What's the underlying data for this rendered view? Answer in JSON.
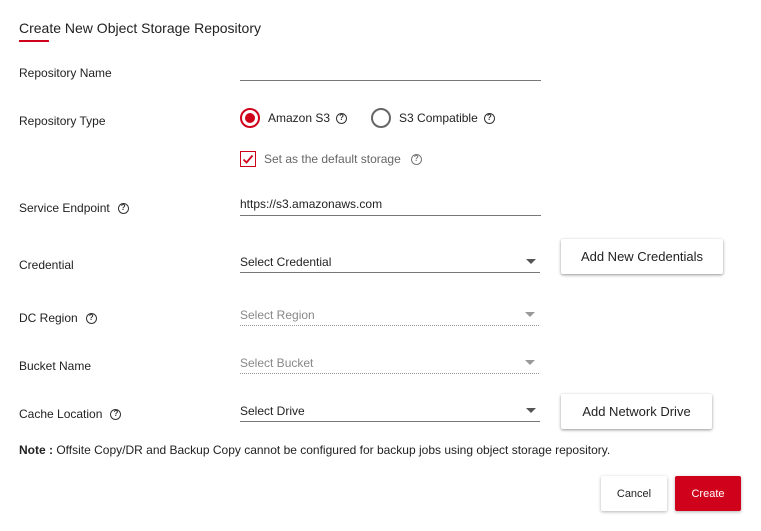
{
  "title": "Create New Object Storage Repository",
  "colors": {
    "accent": "#d0021b"
  },
  "fields": {
    "repository_name": {
      "label": "Repository Name",
      "value": ""
    },
    "repository_type": {
      "label": "Repository Type",
      "options": [
        "Amazon S3",
        "S3 Compatible"
      ],
      "selected": "Amazon S3"
    },
    "default_storage": {
      "label": "Set as the default storage",
      "checked": true
    },
    "service_endpoint": {
      "label": "Service Endpoint",
      "value": "https://s3.amazonaws.com"
    },
    "credential": {
      "label": "Credential",
      "placeholder": "Select Credential",
      "add_button": "Add New Credentials"
    },
    "dc_region": {
      "label": "DC Region",
      "placeholder": "Select Region"
    },
    "bucket_name": {
      "label": "Bucket Name",
      "placeholder": "Select Bucket"
    },
    "cache_location": {
      "label": "Cache Location",
      "placeholder": "Select Drive",
      "add_button": "Add Network Drive"
    }
  },
  "note": {
    "prefix": "Note :",
    "text": " Offsite Copy/DR and Backup Copy cannot be configured for backup jobs using object storage repository."
  },
  "actions": {
    "cancel": "Cancel",
    "create": "Create"
  },
  "icons": {
    "help": "help-circle-icon",
    "check": "check-icon",
    "caret": "caret-down-icon"
  }
}
